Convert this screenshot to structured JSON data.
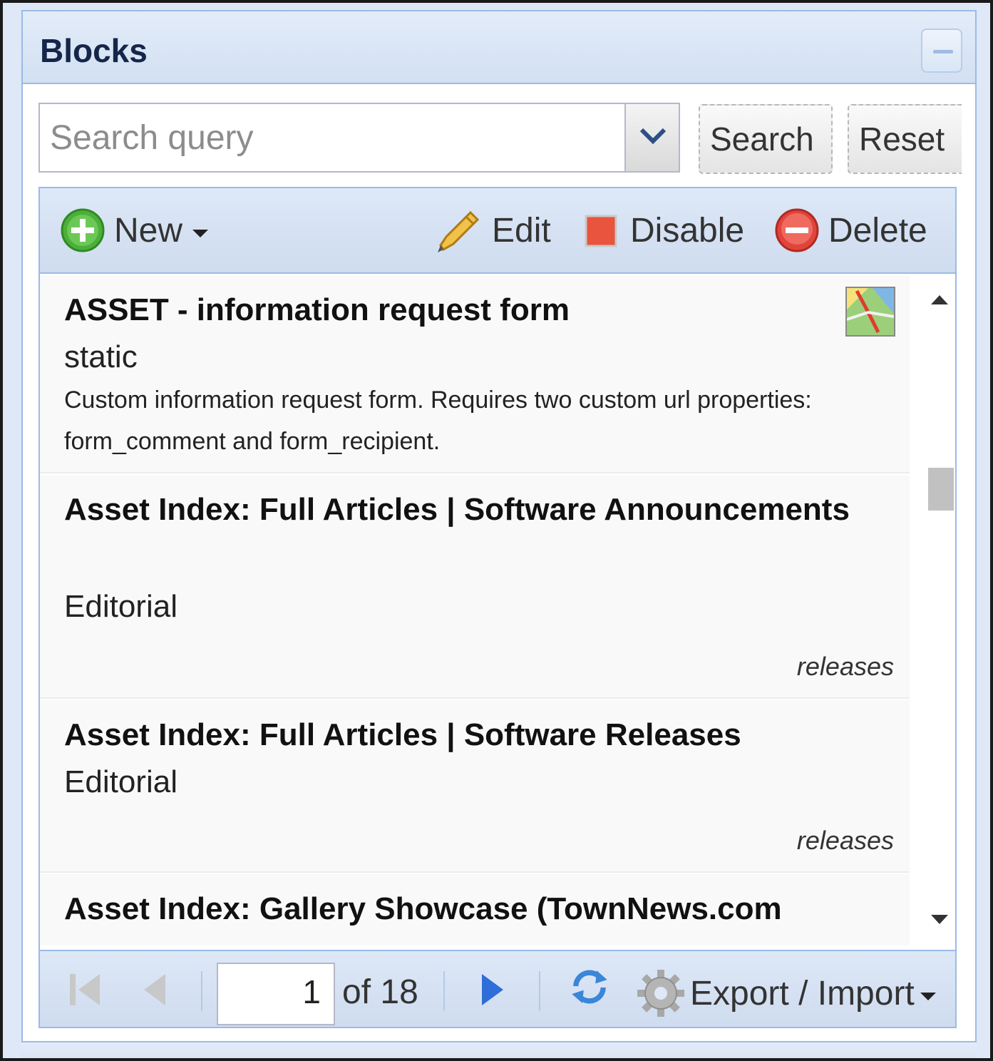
{
  "panel": {
    "title": "Blocks"
  },
  "search": {
    "placeholder": "Search query",
    "value": ""
  },
  "buttons": {
    "search": "Search",
    "reset": "Reset"
  },
  "toolbar": {
    "new_label": "New",
    "edit_label": "Edit",
    "disable_label": "Disable",
    "delete_label": "Delete"
  },
  "rows": [
    {
      "title": "ASSET - information request form",
      "type": "static",
      "description": "Custom information request form. Requires two custom url properties: form_comment and form_recipient.",
      "tag": ""
    },
    {
      "title": "Asset Index: Full Articles | Software Announcements",
      "type": "Editorial",
      "description": "",
      "tag": "releases"
    },
    {
      "title": "Asset Index: Full Articles | Software Releases",
      "type": "Editorial",
      "description": "",
      "tag": "releases"
    },
    {
      "title": "Asset Index: Gallery Showcase (TownNews.com",
      "type": "",
      "description": "",
      "tag": ""
    }
  ],
  "pager": {
    "current_page": "1",
    "of_label": "of 18",
    "export_label": "Export / Import"
  },
  "colors": {
    "header_bg": "#d2e0f2",
    "border": "#99bbe8",
    "title_text": "#15264a",
    "new_icon": "#4caf3a",
    "delete_icon": "#e0443a",
    "disable_icon": "#e8543e",
    "nav_arrow": "#2f6ed8"
  }
}
